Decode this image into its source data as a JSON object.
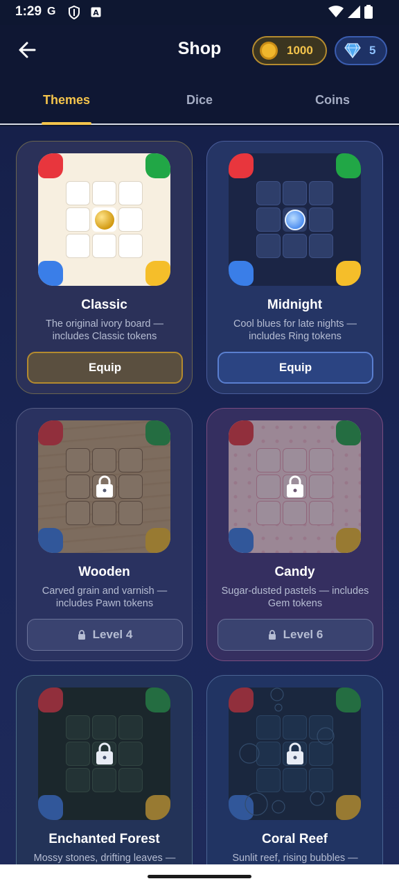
{
  "status": {
    "time": "1:29"
  },
  "header": {
    "title": "Shop",
    "coins": "1000",
    "gems": "5"
  },
  "tabs": [
    {
      "label": "Themes",
      "active": true
    },
    {
      "label": "Dice",
      "active": false
    },
    {
      "label": "Coins",
      "active": false
    }
  ],
  "themes": [
    {
      "name": "Classic",
      "description": "The original ivory board — includes Classic tokens",
      "button": "Equip",
      "locked": false
    },
    {
      "name": "Midnight",
      "description": "Cool blues for late nights — includes Ring tokens",
      "button": "Equip",
      "locked": false
    },
    {
      "name": "Wooden",
      "description": "Carved grain and varnish — includes Pawn tokens",
      "button": "Level 4",
      "locked": true
    },
    {
      "name": "Candy",
      "description": "Sugar-dusted pastels — includes Gem tokens",
      "button": "Level 6",
      "locked": true
    },
    {
      "name": "Enchanted Forest",
      "description": "Mossy stones, drifting leaves —",
      "locked": true
    },
    {
      "name": "Coral Reef",
      "description": "Sunlit reef, rising bubbles —",
      "locked": true
    }
  ],
  "colors": {
    "accent": "#f4c44c",
    "background": "#0d1530",
    "red": "#e8363d",
    "green": "#21a746",
    "blue": "#3a7ee8",
    "yellow": "#f5be2a"
  }
}
